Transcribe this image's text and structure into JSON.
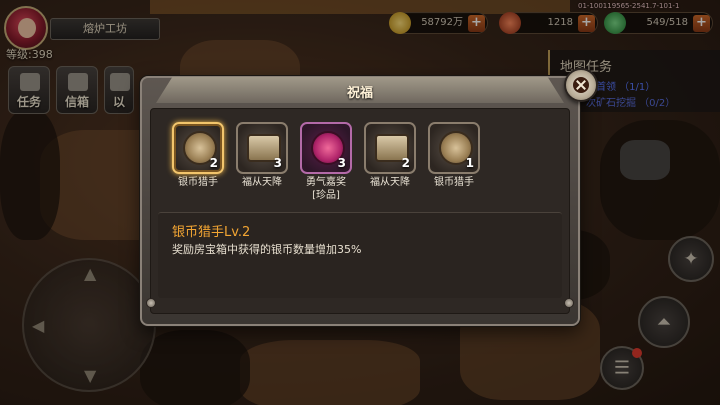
{
  "player": {
    "level_label": "等级:398",
    "location_title": "熔炉工坊"
  },
  "resources": [
    {
      "value": "58792万",
      "icon": "gold-coin-icon",
      "color": "#f4c542"
    },
    {
      "value": "1218",
      "icon": "gem-icon",
      "color": "#e0542a"
    },
    {
      "value": "549/518",
      "icon": "stamina-icon",
      "color": "#46c05a"
    }
  ],
  "build_info": "01-100119565-2541.7-101-1",
  "side_buttons": [
    {
      "label": "任务",
      "icon": "task-icon"
    },
    {
      "label": "信箱",
      "icon": "mail-icon"
    },
    {
      "label": "以",
      "icon": "misc-icon"
    }
  ],
  "map_tasks": {
    "title": "地图任务",
    "rows": [
      {
        "text": "图首领 （1/1）"
      },
      {
        "text": "次矿石挖掘 （0/2）"
      }
    ]
  },
  "dialog": {
    "title": "祝福",
    "items": [
      {
        "name": "银币猎手",
        "count": "2",
        "icon": "silver-coin-hunter-icon",
        "kind": "coin",
        "selected": true
      },
      {
        "name": "福从天降",
        "count": "3",
        "icon": "treasure-chest-icon",
        "kind": "chest",
        "selected": false
      },
      {
        "name": "勇气嘉奖\n[珍品]",
        "count": "3",
        "icon": "courage-badge-icon",
        "kind": "badge",
        "selected": false
      },
      {
        "name": "福从天降",
        "count": "2",
        "icon": "treasure-chest-icon",
        "kind": "chest",
        "selected": false
      },
      {
        "name": "银币猎手",
        "count": "1",
        "icon": "silver-coin-hunter-icon",
        "kind": "coin",
        "selected": false
      }
    ],
    "detail": {
      "title": "银币猎手Lv.2",
      "text": "奖励房宝箱中获得的银币数量增加35%"
    },
    "accent_color": "#f2a533"
  }
}
